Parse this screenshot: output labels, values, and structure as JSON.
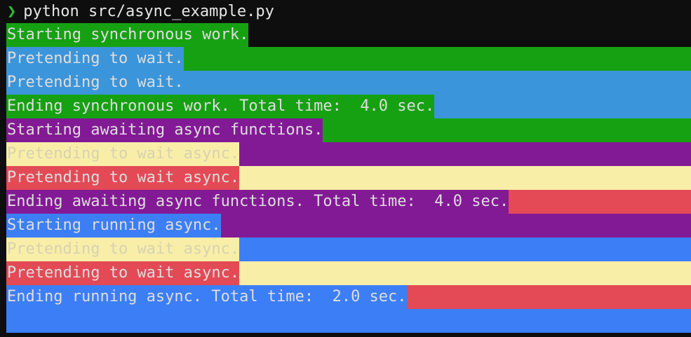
{
  "terminal": {
    "prompt_symbol": "❯",
    "command": "python src/async_example.py",
    "colors": {
      "background": "#0e0e0e",
      "prompt_symbol": "#2fbf3a",
      "green": "#16a113",
      "blue": "#3b95db",
      "purple": "#831a95",
      "yellow": "#f8eea8",
      "red": "#e34a55",
      "bright_blue": "#3c7ef5"
    },
    "lines": [
      {
        "text": "Starting synchronous work.",
        "text_bg": "#16a113",
        "row_bg": "#0e0e0e",
        "fg": "#dedede"
      },
      {
        "text": "Pretending to wait.",
        "text_bg": "#3b95db",
        "row_bg": "#16a113",
        "fg": "#dedede"
      },
      {
        "text": "Pretending to wait.",
        "text_bg": "#3b95db",
        "row_bg": "#3b95db",
        "fg": "#dedede"
      },
      {
        "text": "Ending synchronous work. Total time:  4.0 sec.",
        "text_bg": "#16a113",
        "row_bg": "#3b95db",
        "fg": "#dedede"
      },
      {
        "text": "Starting awaiting async functions.",
        "text_bg": "#831a95",
        "row_bg": "#16a113",
        "fg": "#dedede"
      },
      {
        "text": "Pretending to wait async.",
        "text_bg": "#f8eea8",
        "row_bg": "#831a95",
        "fg": "#d8d2b0"
      },
      {
        "text": "Pretending to wait async.",
        "text_bg": "#e34a55",
        "row_bg": "#f8eea8",
        "fg": "#dedede"
      },
      {
        "text": "Ending awaiting async functions. Total time:  4.0 sec.",
        "text_bg": "#831a95",
        "row_bg": "#e34a55",
        "fg": "#dedede"
      },
      {
        "text": "Starting running async.",
        "text_bg": "#3c7ef5",
        "row_bg": "#831a95",
        "fg": "#dedede"
      },
      {
        "text": "Pretending to wait async.",
        "text_bg": "#f8eea8",
        "row_bg": "#3c7ef5",
        "fg": "#d8d2b0"
      },
      {
        "text": "Pretending to wait async.",
        "text_bg": "#e34a55",
        "row_bg": "#f8eea8",
        "fg": "#dedede"
      },
      {
        "text": "Ending running async. Total time:  2.0 sec.",
        "text_bg": "#3c7ef5",
        "row_bg": "#e34a55",
        "fg": "#dedede"
      }
    ],
    "trailing_bg": "#3c7ef5"
  }
}
